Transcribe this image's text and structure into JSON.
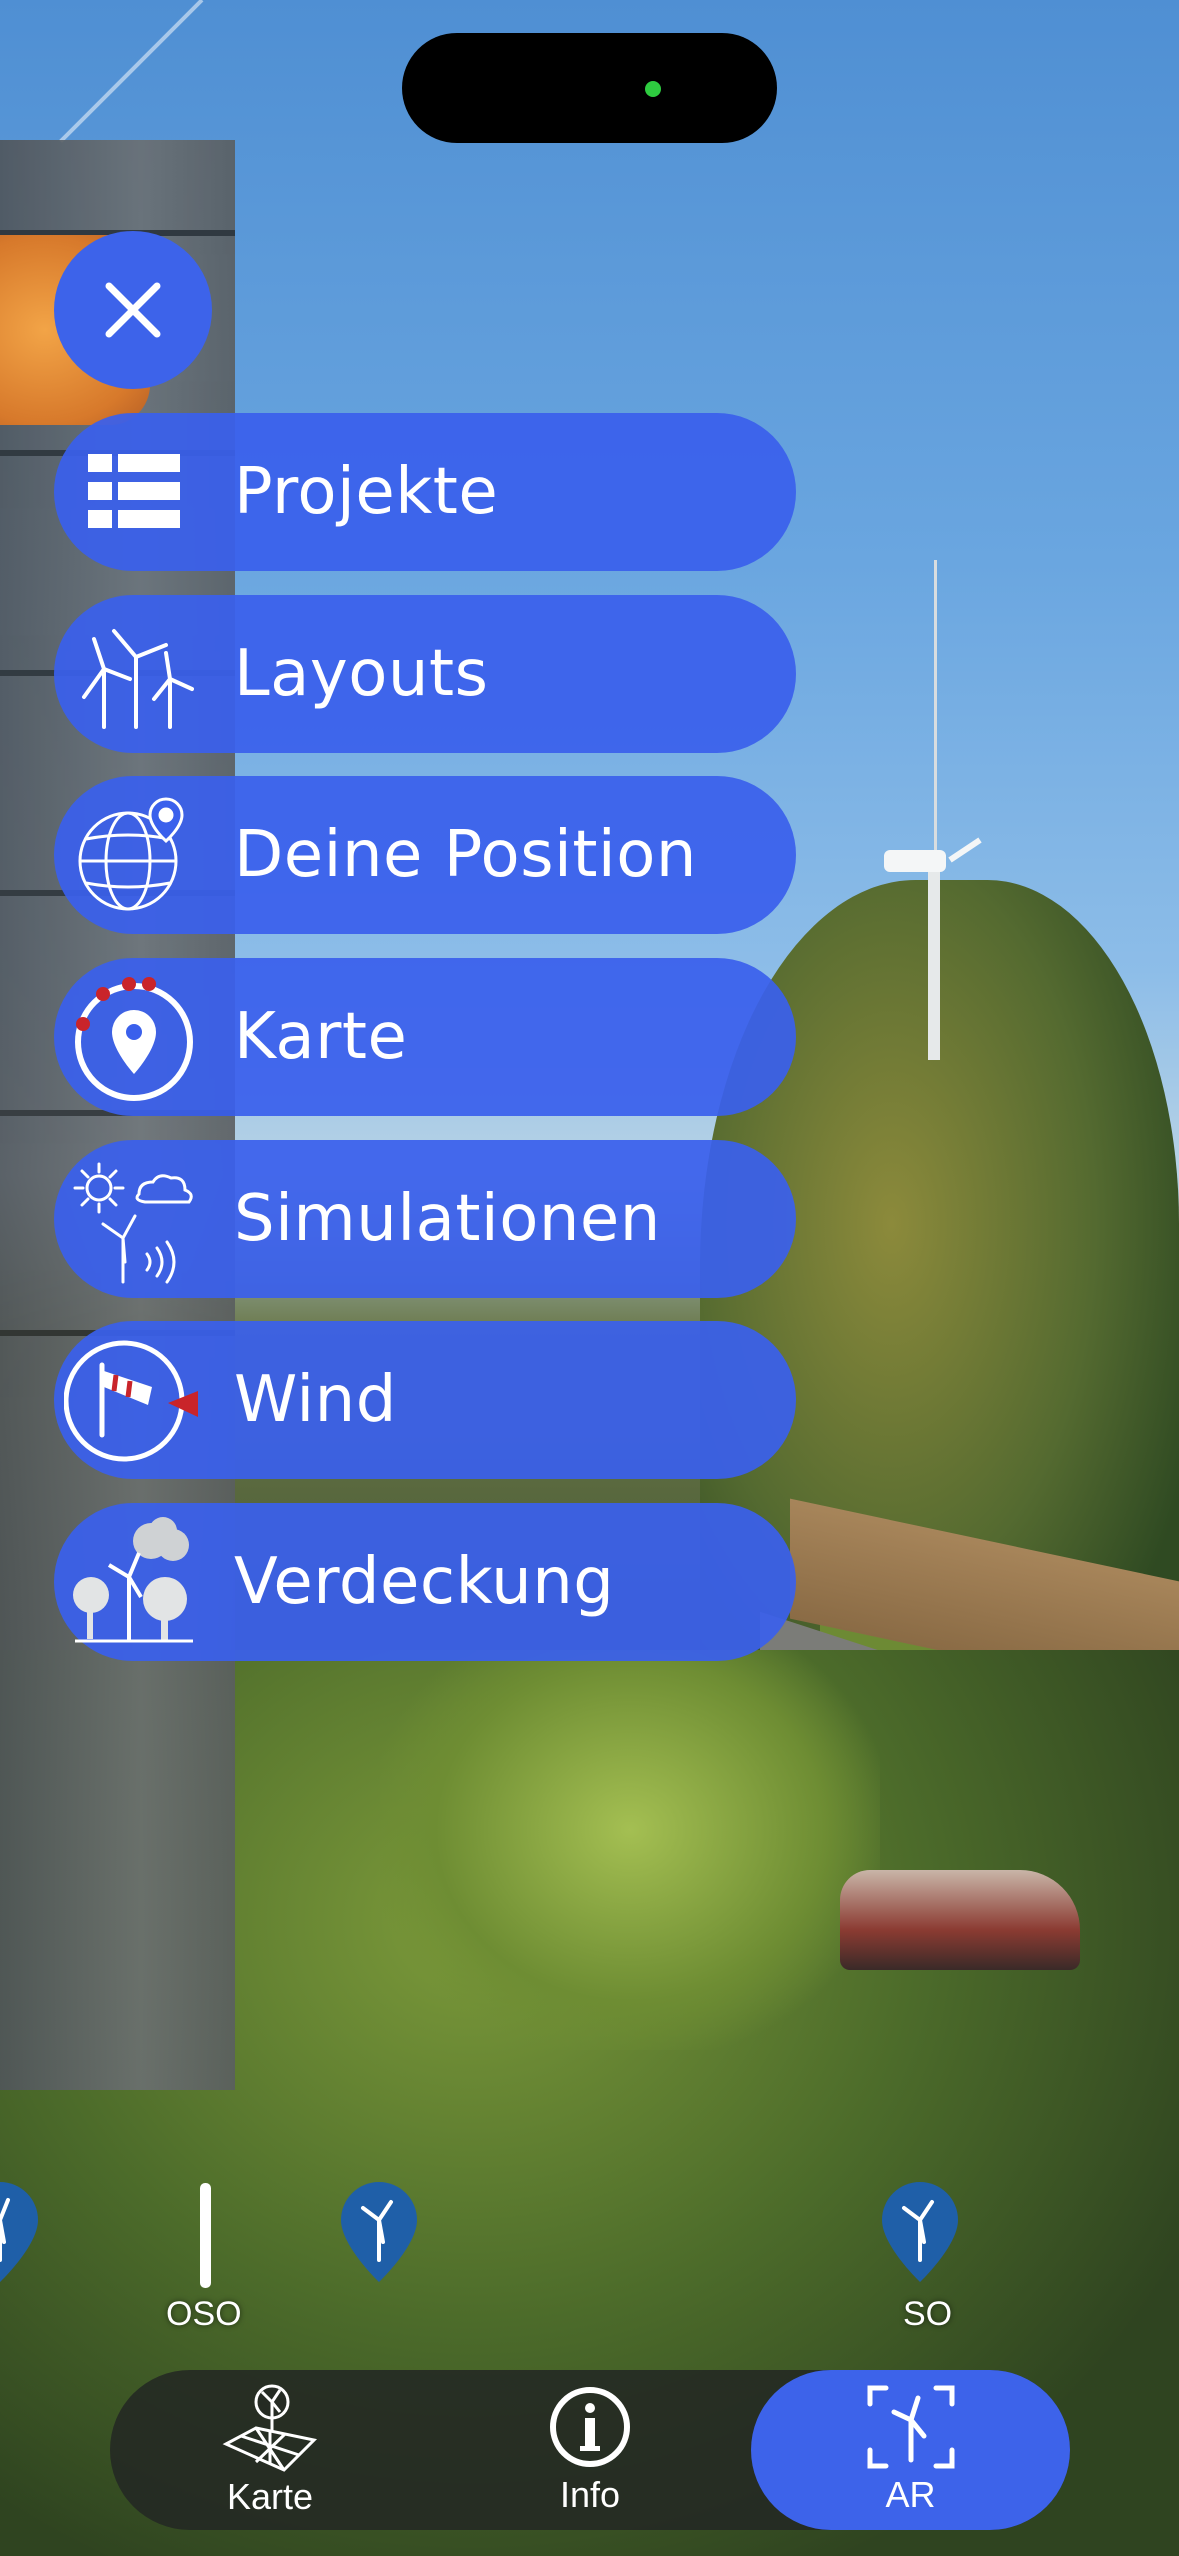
{
  "menu": {
    "close_icon": "close-icon",
    "items": [
      {
        "label": "Projekte",
        "icon": "list-icon"
      },
      {
        "label": "Layouts",
        "icon": "wind-turbines-icon"
      },
      {
        "label": "Deine Position",
        "icon": "globe-location-icon"
      },
      {
        "label": "Karte",
        "icon": "map-pin-compass-icon"
      },
      {
        "label": "Simulationen",
        "icon": "sun-cloud-turbine-icon"
      },
      {
        "label": "Wind",
        "icon": "windsock-icon"
      },
      {
        "label": "Verdeckung",
        "icon": "tree-occlusion-icon"
      }
    ]
  },
  "ar_overlay": {
    "compass": [
      "OSO",
      "SO"
    ],
    "marker_icon": "turbine-pin-icon"
  },
  "tabbar": {
    "tabs": [
      {
        "label": "Karte",
        "icon": "map-turbine-icon"
      },
      {
        "label": "Info",
        "icon": "info-icon"
      },
      {
        "label": "AR",
        "icon": "ar-scan-turbine-icon"
      }
    ],
    "active": "AR"
  },
  "colors": {
    "accent": "#3d63ea",
    "tabbar_bg": "#23282380"
  }
}
